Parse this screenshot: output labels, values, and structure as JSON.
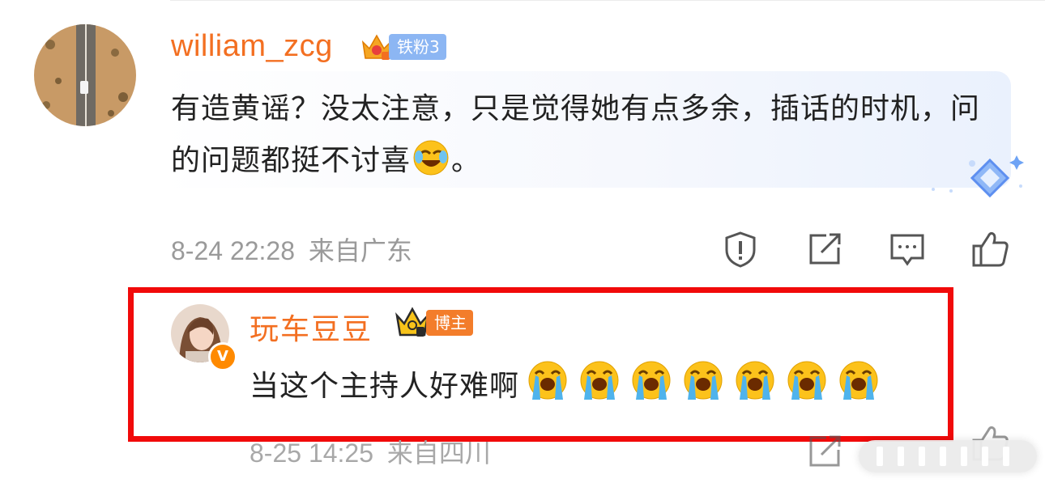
{
  "comment": {
    "username": "william_zcg",
    "fan_badge": "铁粉3",
    "text": "有造黄谣？没太注意，只是觉得她有点多余，插话的时机，问的问题都挺不讨喜",
    "text_suffix": "。",
    "emoji_icon": "laughing-tears-emoji",
    "time": "8-24 22:28",
    "location": "来自广东",
    "actions": [
      "report-icon",
      "share-icon",
      "reply-icon",
      "like-icon"
    ]
  },
  "reply": {
    "username": "玩车豆豆",
    "role_badge": "博主",
    "verified_badge": "V",
    "text": "当这个主持人好难啊",
    "emoji_icon": "crying-emoji",
    "emoji_count": 7,
    "time": "8-25 14:25",
    "location": "来自四川"
  },
  "colors": {
    "username": "#f36f21",
    "highlight_border": "#f10a0a",
    "fan_badge": "#8cb6f3",
    "blogger_badge": "#f37d2b",
    "meta_text": "#9a9a9a"
  }
}
